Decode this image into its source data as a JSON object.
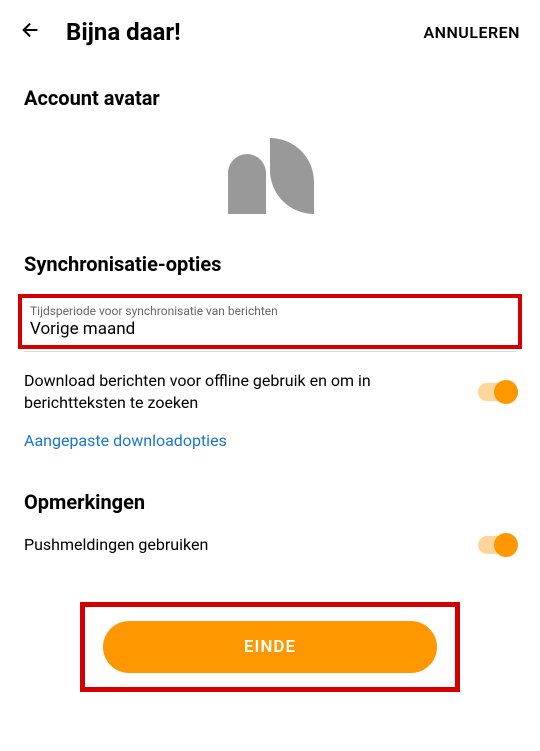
{
  "header": {
    "title": "Bijna daar!",
    "cancel": "ANNULEREN"
  },
  "sections": {
    "avatar": "Account avatar",
    "sync": "Synchronisatie-opties",
    "remarks": "Opmerkingen"
  },
  "sync_field": {
    "label": "Tijdsperiode voor synchronisatie van berichten",
    "value": "Vorige maand"
  },
  "download": {
    "text": "Download berichten voor offline gebruik en om in berichtteksten te zoeken",
    "link": "Aangepaste downloadopties"
  },
  "push": {
    "text": "Pushmeldingen gebruiken"
  },
  "button": {
    "label": "EINDE"
  }
}
